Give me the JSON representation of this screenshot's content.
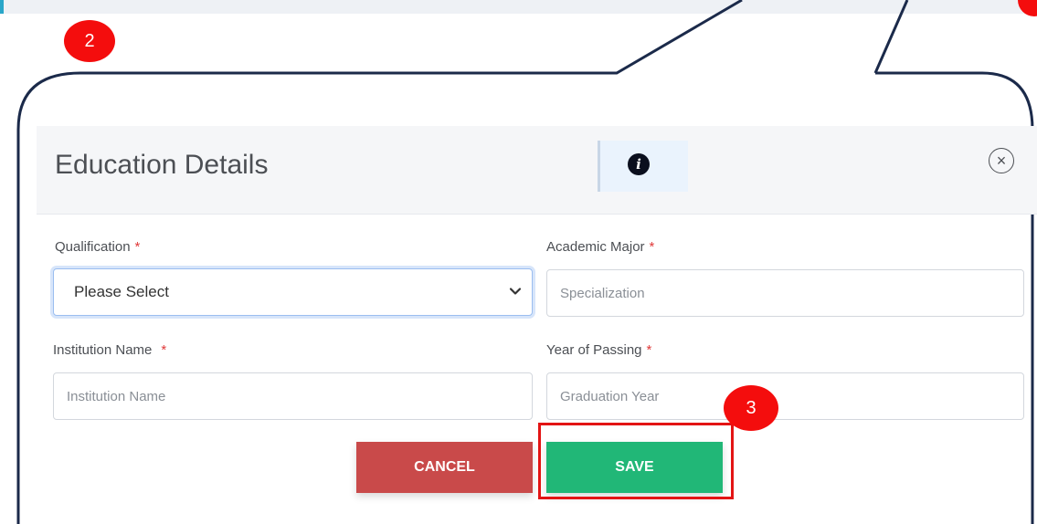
{
  "annotations": {
    "step_2": "2",
    "step_3": "3"
  },
  "modal": {
    "title": "Education Details",
    "info_glyph": "i",
    "close_glyph": "×"
  },
  "form": {
    "qualification": {
      "label": "Qualification",
      "required_mark": "*",
      "selected": "Please Select"
    },
    "academic_major": {
      "label": "Academic Major",
      "required_mark": "*",
      "placeholder": "Specialization"
    },
    "institution_name": {
      "label": "Institution Name",
      "required_mark": "*",
      "placeholder": "Institution Name"
    },
    "year_of_passing": {
      "label": "Year of Passing",
      "required_mark": "*",
      "placeholder": "Graduation Year"
    }
  },
  "actions": {
    "cancel_label": "CANCEL",
    "save_label": "SAVE"
  },
  "colors": {
    "annotation_red": "#f40d0d",
    "cancel_button": "#c94a4a",
    "save_button": "#21b777",
    "required_asterisk": "#e03a3a"
  }
}
